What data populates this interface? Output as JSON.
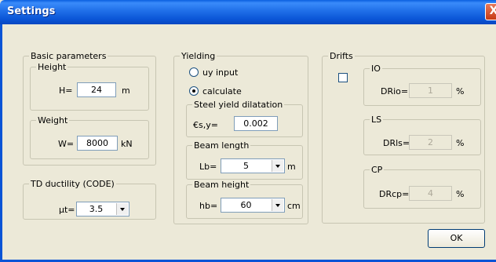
{
  "window": {
    "title": "Settings",
    "close_glyph": "X"
  },
  "basic": {
    "title": "Basic parameters",
    "height": {
      "title": "Height",
      "label": "H=",
      "value": "24",
      "unit": "m"
    },
    "weight": {
      "title": "Weight",
      "label": "W=",
      "value": "8000",
      "unit": "kN"
    }
  },
  "td": {
    "title": "TD ductility (CODE)",
    "label": "µt=",
    "value": "3.5"
  },
  "yielding": {
    "title": "Yielding",
    "radio_input": "uy input",
    "radio_calc": "calculate",
    "selected": "calculate",
    "steel": {
      "title": "Steel yield dilatation",
      "label": "€s,y=",
      "value": "0.002"
    },
    "beam_length": {
      "title": "Beam length",
      "label": "Lb=",
      "value": "5",
      "unit": "m"
    },
    "beam_height": {
      "title": "Beam height",
      "label": "hb=",
      "value": "60",
      "unit": "cm"
    }
  },
  "drifts": {
    "title": "Drifts",
    "checked": false,
    "io": {
      "title": "IO",
      "label": "DRio=",
      "value": "1",
      "unit": "%"
    },
    "ls": {
      "title": "LS",
      "label": "DRls=",
      "value": "2",
      "unit": "%"
    },
    "cp": {
      "title": "CP",
      "label": "DRcp=",
      "value": "4",
      "unit": "%"
    }
  },
  "ok_label": "OK",
  "icons": {
    "close": "close-icon",
    "dropdown": "chevron-down-icon"
  }
}
